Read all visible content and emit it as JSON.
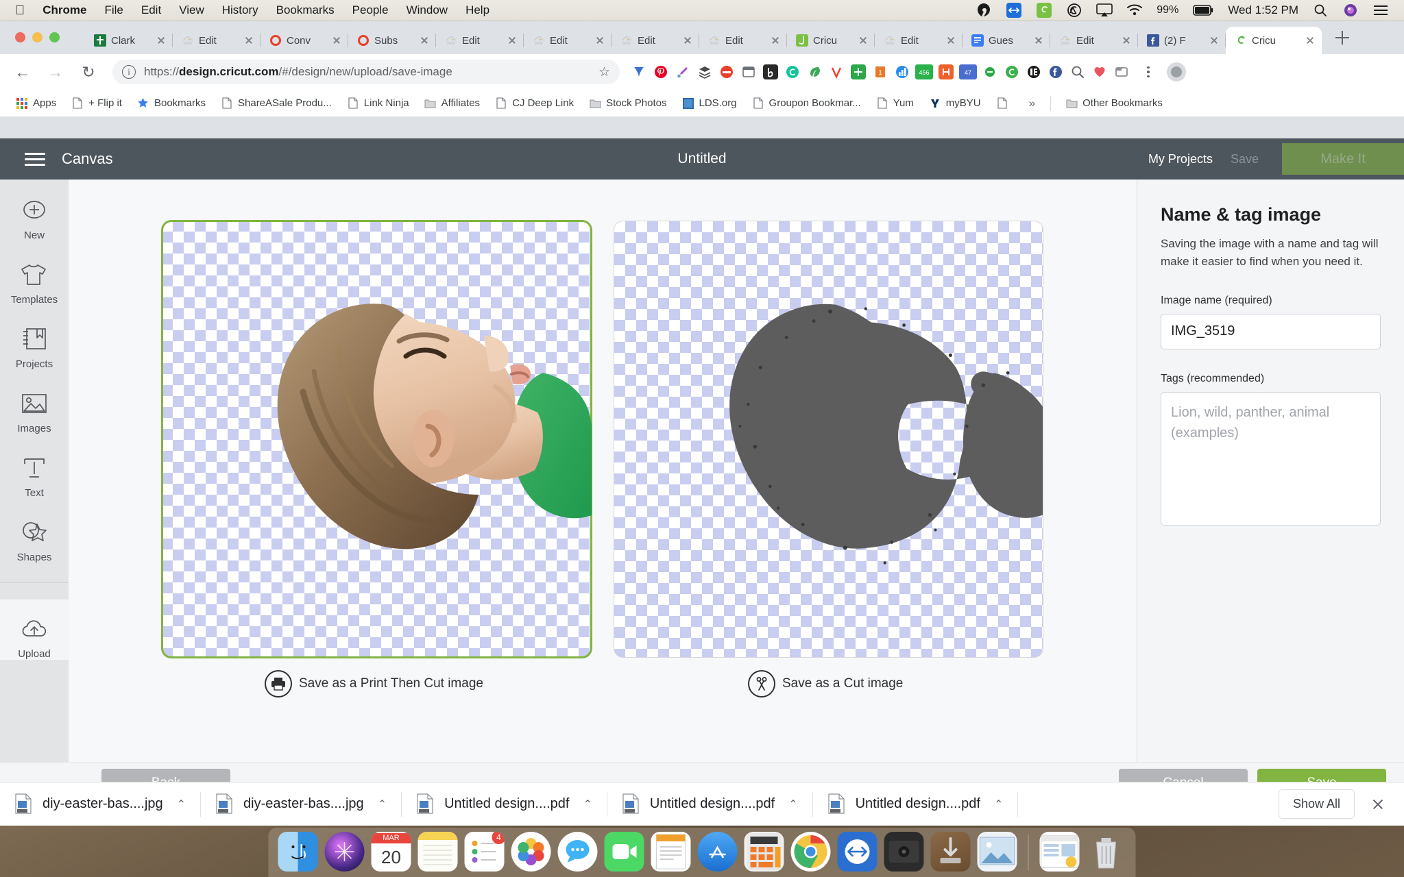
{
  "macos": {
    "apple_icon": "apple-logo-icon",
    "menus": [
      {
        "label": "Chrome",
        "bold": true
      },
      {
        "label": "File",
        "bold": false
      },
      {
        "label": "Edit",
        "bold": false
      },
      {
        "label": "View",
        "bold": false
      },
      {
        "label": "History",
        "bold": false
      },
      {
        "label": "Bookmarks",
        "bold": false
      },
      {
        "label": "People",
        "bold": false
      },
      {
        "label": "Window",
        "bold": false
      },
      {
        "label": "Help",
        "bold": false
      }
    ],
    "tray": {
      "battery_percent": "99%",
      "clock": "Wed 1:52 PM",
      "icons": [
        "grammarly-icon",
        "teamviewer-icon",
        "cricut-icon",
        "creative-cloud-icon",
        "airplay-icon",
        "wifi-icon",
        "battery-icon",
        "spotlight-search-icon",
        "siri-icon",
        "control-center-icon"
      ]
    }
  },
  "browser": {
    "tabs": [
      {
        "title": "Clark",
        "favicon": "bible-app-icon",
        "active": false
      },
      {
        "title": "Edit",
        "favicon": "home-depot-icon",
        "active": false
      },
      {
        "title": "Conv",
        "favicon": "ulysses-icon",
        "active": false
      },
      {
        "title": "Subs",
        "favicon": "ulysses-icon",
        "active": false
      },
      {
        "title": "Edit",
        "favicon": "home-depot-icon",
        "active": false
      },
      {
        "title": "Edit",
        "favicon": "home-depot-icon",
        "active": false
      },
      {
        "title": "Edit",
        "favicon": "home-depot-icon",
        "active": false
      },
      {
        "title": "Edit",
        "favicon": "home-depot-icon",
        "active": false
      },
      {
        "title": "Cricu",
        "favicon": "jotform-icon",
        "active": false
      },
      {
        "title": "Edit",
        "favicon": "home-depot-icon",
        "active": false
      },
      {
        "title": "Gues",
        "favicon": "google-docs-icon",
        "active": false
      },
      {
        "title": "Edit",
        "favicon": "home-depot-icon",
        "active": false
      },
      {
        "title": "(2) F",
        "favicon": "facebook-icon",
        "active": false
      },
      {
        "title": "Cricu",
        "favicon": "cricut-icon",
        "active": true
      }
    ],
    "new_tab_label": "+",
    "nav": {
      "back": "←",
      "forward": "→",
      "reload": "↻"
    },
    "omnibox": {
      "scheme": "https://",
      "domain": "design.cricut.com",
      "path": "/#/design/new/upload/save-image",
      "full_url": "https://design.cricut.com/#/design/new/upload/save-image",
      "security_icon": "info-circle-icon",
      "bookmark_icon": "star-icon"
    },
    "extensions": [
      "pinterest-save-icon",
      "pinterest-icon",
      "colorzilla-icon",
      "layers-icon",
      "ninja-icon",
      "window-icon",
      "bitly-icon",
      "grammarly-icon",
      "leaf-icon",
      "vegan-icon",
      "sale-tag-icon",
      "chart-icon",
      "seo-icon",
      "honey-icon",
      "clipboard-47-icon",
      "ebates-icon",
      "grammarly-green-icon",
      "kindle-icon",
      "facebook-icon",
      "search-icon",
      "heart-icon",
      "tab-icon",
      "profile-icon"
    ],
    "bookmarks": [
      {
        "label": "Apps",
        "icon": "apps-grid-icon"
      },
      {
        "label": "+ Flip it",
        "icon": "page-icon"
      },
      {
        "label": "Bookmarks",
        "icon": "star-icon"
      },
      {
        "label": "ShareASale Produ...",
        "icon": "page-icon"
      },
      {
        "label": "Link Ninja",
        "icon": "page-icon"
      },
      {
        "label": "Affiliates",
        "icon": "folder-icon"
      },
      {
        "label": "CJ Deep Link",
        "icon": "page-icon"
      },
      {
        "label": "Stock Photos",
        "icon": "folder-icon"
      },
      {
        "label": "LDS.org",
        "icon": "lds-icon"
      },
      {
        "label": "Groupon Bookmar...",
        "icon": "page-icon"
      },
      {
        "label": "Yum",
        "icon": "page-icon"
      },
      {
        "label": "myBYU",
        "icon": "byu-icon"
      },
      {
        "label": "",
        "icon": "page-icon"
      }
    ],
    "overflow_label": "»",
    "other_bookmarks": {
      "label": "Other Bookmarks",
      "icon": "folder-icon"
    }
  },
  "app": {
    "header": {
      "menu_icon": "hamburger-menu-icon",
      "canvas_label": "Canvas",
      "project_title": "Untitled",
      "my_projects_label": "My Projects",
      "save_label": "Save",
      "make_it_label": "Make It"
    },
    "sidebar": [
      {
        "label": "New",
        "icon": "plus-circle-icon"
      },
      {
        "label": "Templates",
        "icon": "tshirt-icon"
      },
      {
        "label": "Projects",
        "icon": "book-bookmark-icon"
      },
      {
        "label": "Images",
        "icon": "photo-icon"
      },
      {
        "label": "Text",
        "icon": "text-t-icon"
      },
      {
        "label": "Shapes",
        "icon": "shapes-icon"
      },
      {
        "label": "Upload",
        "icon": "cloud-upload-icon"
      }
    ],
    "previews": [
      {
        "caption": "Save as a Print Then Cut image",
        "icon": "printer-icon",
        "selected": true,
        "kind": "photo"
      },
      {
        "caption": "Save as a Cut image",
        "icon": "scissors-icon",
        "selected": false,
        "kind": "silhouette"
      }
    ],
    "panel": {
      "title": "Name & tag image",
      "description": "Saving the image with a name and tag will make it easier to find when you need it.",
      "image_name_label": "Image name (required)",
      "image_name_value": "IMG_3519",
      "tags_label": "Tags (recommended)",
      "tags_value": "",
      "tags_placeholder": "Lion, wild, panther, animal (examples)"
    },
    "footer": {
      "back_label": "Back",
      "cancel_label": "Cancel",
      "save_label": "Save"
    },
    "colors": {
      "accent_green": "#81b441",
      "header_dark": "#4e565d",
      "button_grey": "#b3b5b8"
    }
  },
  "downloads": {
    "items": [
      {
        "name": "diy-easter-bas....jpg",
        "icon": "jpeg-file-icon",
        "caret": "⌃"
      },
      {
        "name": "diy-easter-bas....jpg",
        "icon": "jpeg-file-icon",
        "caret": "⌃"
      },
      {
        "name": "Untitled design....pdf",
        "icon": "pdf-file-icon",
        "caret": "⌃"
      },
      {
        "name": "Untitled design....pdf",
        "icon": "pdf-file-icon",
        "caret": "⌃"
      },
      {
        "name": "Untitled design....pdf",
        "icon": "pdf-file-icon",
        "caret": "⌃"
      }
    ],
    "show_all_label": "Show All",
    "close_icon": "close-icon"
  },
  "dock": {
    "items": [
      {
        "name": "finder-icon",
        "color": "#3f8df0"
      },
      {
        "name": "siri-icon",
        "color": "#1b1b2a"
      },
      {
        "name": "calendar-icon",
        "color": "#ffffff",
        "month": "MAR",
        "day": "20"
      },
      {
        "name": "notes-icon",
        "color": "#fdfdfb"
      },
      {
        "name": "reminders-icon",
        "color": "#ffffff",
        "badge": "4"
      },
      {
        "name": "photos-icon",
        "color": "#ffffff"
      },
      {
        "name": "messages-icon",
        "color": "#3fb3f5"
      },
      {
        "name": "facetime-icon",
        "color": "#4bd865"
      },
      {
        "name": "pages-icon",
        "color": "#f5a623"
      },
      {
        "name": "app-store-icon",
        "color": "#2a8ef0"
      },
      {
        "name": "calculator-icon",
        "color": "#f05a28"
      },
      {
        "name": "chrome-icon",
        "color": "#ffffff"
      },
      {
        "name": "teamviewer-icon",
        "color": "#2a6fd0"
      },
      {
        "name": "hard-drive-icon",
        "color": "#2b2b2b"
      },
      {
        "name": "downloads-stack-icon",
        "color": "#8a6a48"
      },
      {
        "name": "preview-icon",
        "color": "#e8eef5"
      },
      {
        "name": "recent-window-icon",
        "color": "#ffffff"
      },
      {
        "name": "trash-icon",
        "color": "#d8d8d8"
      }
    ]
  }
}
